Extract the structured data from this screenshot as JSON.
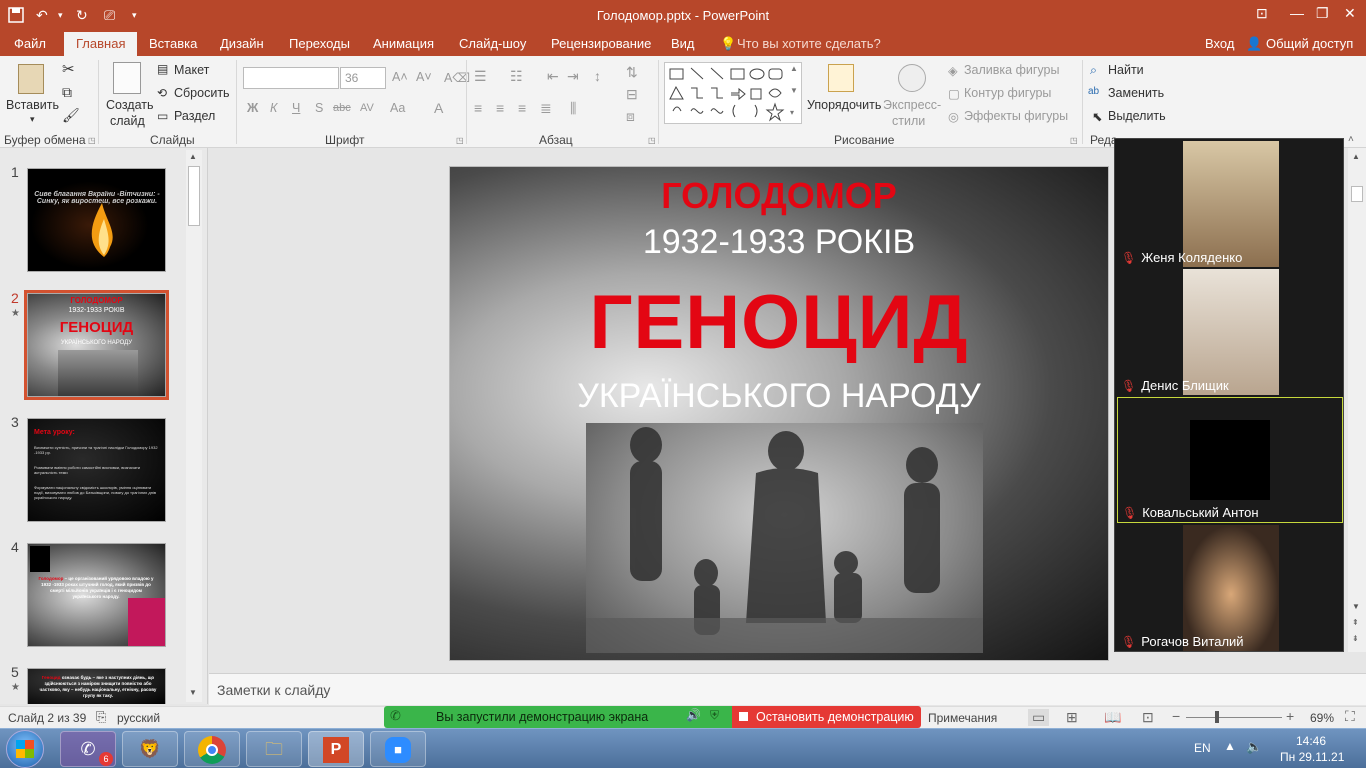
{
  "window": {
    "title": "Голодомор.pptx - PowerPoint"
  },
  "tabs": [
    "Файл",
    "Главная",
    "Вставка",
    "Дизайн",
    "Переходы",
    "Анимация",
    "Слайд-шоу",
    "Рецензирование",
    "Вид"
  ],
  "tell_me": "Что вы хотите сделать?",
  "account": {
    "login": "Вход",
    "share": "Общий доступ"
  },
  "ribbon": {
    "clipboard": {
      "paste": "Вставить",
      "label": "Буфер обмена"
    },
    "slides": {
      "new_slide": "Создать",
      "new_slide2": "слайд",
      "layout": "Макет",
      "reset": "Сбросить",
      "section": "Раздел",
      "label": "Слайды"
    },
    "font": {
      "size": "36",
      "label": "Шрифт",
      "bold": "Ж",
      "italic": "К",
      "underline": "Ч",
      "shadow": "S",
      "strike": "abc",
      "spacing": "AV",
      "case": "Aa",
      "color": "A"
    },
    "paragraph": {
      "label": "Абзац"
    },
    "drawing": {
      "arrange": "Упорядочить",
      "styles": "Экспресс-",
      "styles2": "стили",
      "fill": "Заливка фигуры",
      "outline": "Контур фигуры",
      "effects": "Эффекты фигуры",
      "label": "Рисование"
    },
    "editing": {
      "find": "Найти",
      "replace": "Заменить",
      "select": "Выделить",
      "label": "Реда"
    }
  },
  "thumbnails": [
    {
      "num": "1",
      "star": false,
      "text": "Сиве благання Вкраїни -Вітчизни: - Синку, як виростеш, все розкажи."
    },
    {
      "num": "2",
      "star": true,
      "t1": "ГОЛОДОМОР",
      "t2": "1932-1933 РОКІВ",
      "t3": "ГЕНОЦИД",
      "t4": "УКРАЇНСЬКОГО НАРОДУ"
    },
    {
      "num": "3",
      "star": false,
      "title": "Мета уроку:",
      "body": [
        "Визначити сутність, причини та трагічні наслідки Голодомору 1932 -1933 рр.",
        "Розвивати вміння роботи самостійні висновки, визначати актуальність теми",
        "Формувати національну свідомість школярів, уміння оцінювати події, виховувати любов до Батьківщини, повагу до трагічних днів українського народу."
      ]
    },
    {
      "num": "4",
      "star": false,
      "red": "Голодомор",
      "body": " – це організований урядовою владою у 1932 -1933 роках штучний голод, який призвів до смерті мільйонів українців і є геноцидом українського народу."
    },
    {
      "num": "5",
      "star": true,
      "red": "Геноцид",
      "body": " означає будь – яке з наступних діянь, що здійснюються з наміром знищити повністю або частково, яку – небудь національну, етнічну, расову групу як таку."
    }
  ],
  "slide": {
    "title1": "ГОЛОДОМОР",
    "title2": "1932-1933 РОКІВ",
    "title3": "ГЕНОЦИД",
    "title4": "УКРАЇНСЬКОГО НАРОДУ"
  },
  "notes": "Заметки к слайду",
  "status": {
    "slide": "Слайд 2 из 39",
    "lang": "русский",
    "notes": "Примечания",
    "zoom": "69%"
  },
  "share": {
    "running": "Вы запустили демонстрацию экрана",
    "stop": "Остановить демонстрацию"
  },
  "participants": [
    {
      "name": "Женя Коляденко"
    },
    {
      "name": "Денис Блищик"
    },
    {
      "name": "Ковальський Антон"
    },
    {
      "name": "Рогачов Виталий"
    }
  ],
  "taskbar": {
    "lang": "EN",
    "time": "14:46",
    "date": "Пн 29.11.21",
    "viber_badge": "6"
  },
  "colors": {
    "accent": "#b7472a",
    "red": "#e30613",
    "share_green": "#3ab54a",
    "stop_red": "#e53935"
  }
}
